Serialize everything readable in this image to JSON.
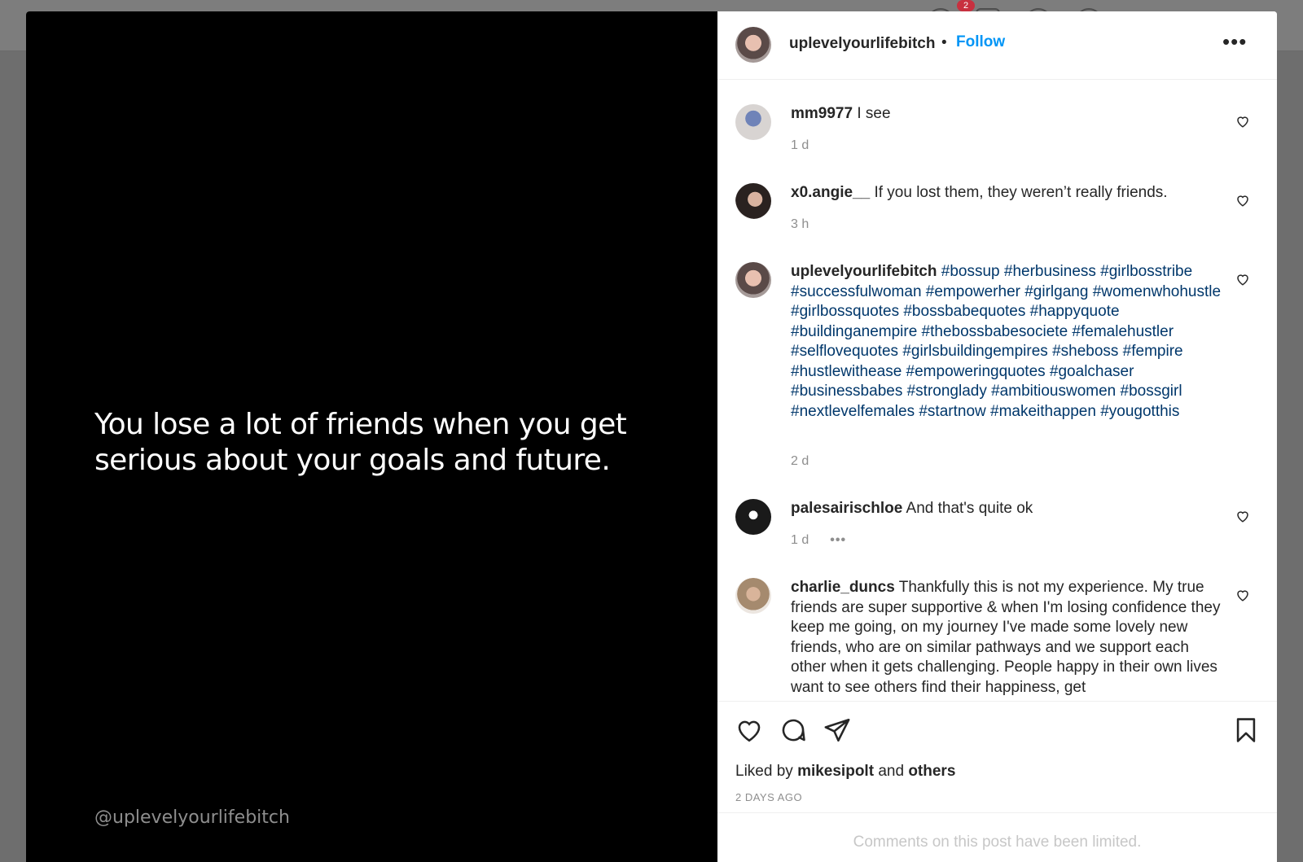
{
  "post": {
    "quote": "You lose a lot of friends when you get serious about your goals and future.",
    "watermark": "@uplevelyourlifebitch"
  },
  "header": {
    "username": "uplevelyourlifebitch",
    "separator": "•",
    "follow_label": "Follow",
    "more_label": "•••"
  },
  "comments": [
    {
      "user": "mm9977",
      "text": "I see",
      "time": "1 d"
    },
    {
      "user": "x0.angie__",
      "text": "If you lost them, they weren’t really friends.",
      "time": "3 h"
    },
    {
      "user": "uplevelyourlifebitch",
      "tags": "#bossup #herbusiness #girlbosstribe #successfulwoman #empowerher #girlgang #womenwhohustle #girlbossquotes #bossbabequotes #happyquote #buildinganempire #thebossbabesociete #femalehustler #selflovequotes #girlsbuildingempires #sheboss #fempire #hustlewithease #empoweringquotes #goalchaser #businessbabes #stronglady #ambitiouswomen #bossgirl #nextlevelfemales #startnow #makeithappen #yougotthis",
      "time": "2 d"
    },
    {
      "user": "palesairischloe",
      "text": "And that's quite ok",
      "time": "1 d",
      "more": "•••"
    },
    {
      "user": "charlie_duncs",
      "text": "Thankfully this is not my experience. My true friends are super supportive & when I'm losing confidence they keep me going, on my journey I've made some lovely new friends, who are on similar pathways and we support each other when it gets challenging. People happy in their own lives want to see others find their happiness, get"
    }
  ],
  "actions": {
    "liked_prefix": "Liked by",
    "liked_user": "mikesipolt",
    "liked_and": "and",
    "liked_others": "others",
    "posted": "2 DAYS AGO",
    "limited": "Comments on this post have been limited."
  },
  "backdrop": {
    "notification_count": "2"
  },
  "colors": {
    "link": "#0095f6",
    "hashtag": "#00376b",
    "text": "#262626",
    "muted": "#8e8e8e"
  },
  "icons": [
    "heart-icon",
    "comment-icon",
    "share-icon",
    "bookmark-icon",
    "more-icon"
  ]
}
